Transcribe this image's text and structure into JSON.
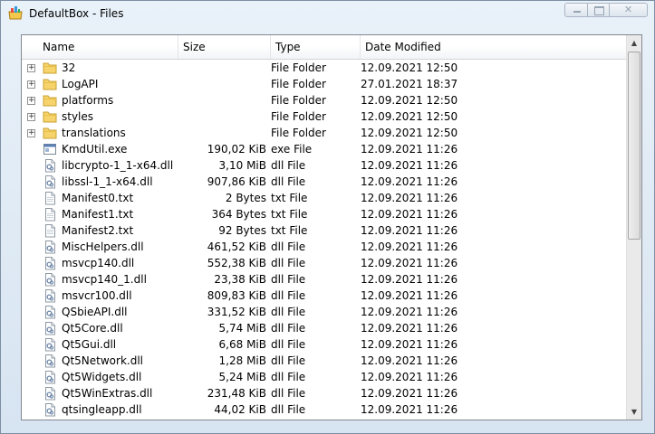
{
  "window": {
    "title": "DefaultBox - Files"
  },
  "columns": {
    "name": "Name",
    "size": "Size",
    "type": "Type",
    "date": "Date Modified"
  },
  "files": [
    {
      "name": "32",
      "size": "",
      "type": "File Folder",
      "date": "12.09.2021 12:50",
      "icon": "folder-icon",
      "expandable": true
    },
    {
      "name": "LogAPI",
      "size": "",
      "type": "File Folder",
      "date": "27.01.2021 18:37",
      "icon": "folder-icon",
      "expandable": true
    },
    {
      "name": "platforms",
      "size": "",
      "type": "File Folder",
      "date": "12.09.2021 12:50",
      "icon": "folder-icon",
      "expandable": true
    },
    {
      "name": "styles",
      "size": "",
      "type": "File Folder",
      "date": "12.09.2021 12:50",
      "icon": "folder-icon",
      "expandable": true
    },
    {
      "name": "translations",
      "size": "",
      "type": "File Folder",
      "date": "12.09.2021 12:50",
      "icon": "folder-icon",
      "expandable": true
    },
    {
      "name": "KmdUtil.exe",
      "size": "190,02 KiB",
      "type": "exe File",
      "date": "12.09.2021 11:26",
      "icon": "exe-icon",
      "expandable": false
    },
    {
      "name": "libcrypto-1_1-x64.dll",
      "size": "3,10 MiB",
      "type": "dll File",
      "date": "12.09.2021 11:26",
      "icon": "dll-icon",
      "expandable": false
    },
    {
      "name": "libssl-1_1-x64.dll",
      "size": "907,86 KiB",
      "type": "dll File",
      "date": "12.09.2021 11:26",
      "icon": "dll-icon",
      "expandable": false
    },
    {
      "name": "Manifest0.txt",
      "size": "2 Bytes",
      "type": "txt File",
      "date": "12.09.2021 11:26",
      "icon": "txt-icon",
      "expandable": false
    },
    {
      "name": "Manifest1.txt",
      "size": "364 Bytes",
      "type": "txt File",
      "date": "12.09.2021 11:26",
      "icon": "txt-icon",
      "expandable": false
    },
    {
      "name": "Manifest2.txt",
      "size": "92 Bytes",
      "type": "txt File",
      "date": "12.09.2021 11:26",
      "icon": "txt-icon",
      "expandable": false
    },
    {
      "name": "MiscHelpers.dll",
      "size": "461,52 KiB",
      "type": "dll File",
      "date": "12.09.2021 11:26",
      "icon": "dll-icon",
      "expandable": false
    },
    {
      "name": "msvcp140.dll",
      "size": "552,38 KiB",
      "type": "dll File",
      "date": "12.09.2021 11:26",
      "icon": "dll-icon",
      "expandable": false
    },
    {
      "name": "msvcp140_1.dll",
      "size": "23,38 KiB",
      "type": "dll File",
      "date": "12.09.2021 11:26",
      "icon": "dll-icon",
      "expandable": false
    },
    {
      "name": "msvcr100.dll",
      "size": "809,83 KiB",
      "type": "dll File",
      "date": "12.09.2021 11:26",
      "icon": "dll-icon",
      "expandable": false
    },
    {
      "name": "QSbieAPI.dll",
      "size": "331,52 KiB",
      "type": "dll File",
      "date": "12.09.2021 11:26",
      "icon": "dll-icon",
      "expandable": false
    },
    {
      "name": "Qt5Core.dll",
      "size": "5,74 MiB",
      "type": "dll File",
      "date": "12.09.2021 11:26",
      "icon": "dll-icon",
      "expandable": false
    },
    {
      "name": "Qt5Gui.dll",
      "size": "6,68 MiB",
      "type": "dll File",
      "date": "12.09.2021 11:26",
      "icon": "dll-icon",
      "expandable": false
    },
    {
      "name": "Qt5Network.dll",
      "size": "1,28 MiB",
      "type": "dll File",
      "date": "12.09.2021 11:26",
      "icon": "dll-icon",
      "expandable": false
    },
    {
      "name": "Qt5Widgets.dll",
      "size": "5,24 MiB",
      "type": "dll File",
      "date": "12.09.2021 11:26",
      "icon": "dll-icon",
      "expandable": false
    },
    {
      "name": "Qt5WinExtras.dll",
      "size": "231,48 KiB",
      "type": "dll File",
      "date": "12.09.2021 11:26",
      "icon": "dll-icon",
      "expandable": false
    },
    {
      "name": "qtsingleapp.dll",
      "size": "44,02 KiB",
      "type": "dll File",
      "date": "12.09.2021 11:26",
      "icon": "dll-icon",
      "expandable": false
    }
  ]
}
